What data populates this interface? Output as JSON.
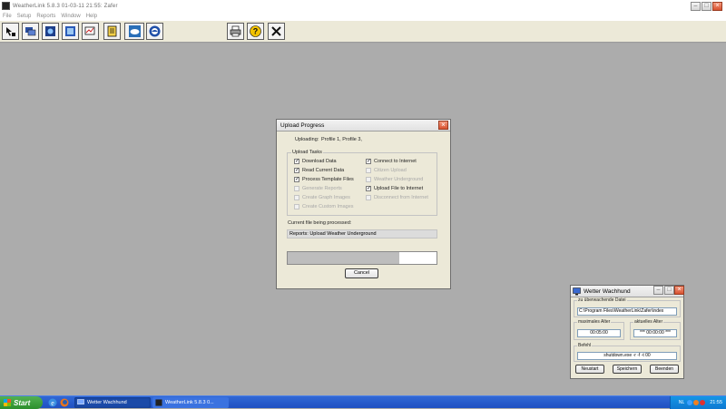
{
  "window": {
    "title": "WeatherLink 5.8.3  01-03-11  21:55: Zafer",
    "menus": [
      "File",
      "Setup",
      "Reports",
      "Window",
      "Help"
    ]
  },
  "toolbar": {
    "buttons": [
      "select-station-icon",
      "walkabout-icon",
      "bulletin-icon",
      "summary-icon",
      "strip-charts-icon",
      "noaa-reports-icon",
      "weather-cloud-icon",
      "noaa-logo-icon",
      "print-icon",
      "help-icon",
      "exit-icon"
    ]
  },
  "upload_dialog": {
    "title": "Upload Progress",
    "uploading_label": "Uploading:",
    "uploading_value": "Profile 1,  Profile 3,",
    "tasks_label": "Upload Tasks",
    "tasks_left": [
      {
        "label": "Download Data",
        "checked": true,
        "enabled": true
      },
      {
        "label": "Read Current Data",
        "checked": true,
        "enabled": true
      },
      {
        "label": "Process Template Files",
        "checked": true,
        "enabled": true
      },
      {
        "label": "Generate Reports",
        "checked": false,
        "enabled": false
      },
      {
        "label": "Create Graph Images",
        "checked": false,
        "enabled": false
      },
      {
        "label": "Create Custom Images",
        "checked": false,
        "enabled": false
      }
    ],
    "tasks_right": [
      {
        "label": "Connect to Internet",
        "checked": true,
        "enabled": true
      },
      {
        "label": "Citizen Upload",
        "checked": false,
        "enabled": false
      },
      {
        "label": "Weather Underground",
        "checked": false,
        "enabled": false
      },
      {
        "label": "Upload File to Internet",
        "checked": true,
        "enabled": true
      },
      {
        "label": "Disconnect from Internet",
        "checked": false,
        "enabled": false
      }
    ],
    "current_file_label": "Current file being processed:",
    "current_file_value": "Reports: Upload Weather Underground",
    "progress": 0.75,
    "cancel_label": "Cancel"
  },
  "watchdog": {
    "title": "Wetter Wachhund",
    "file_label": "zu überwachende Datei",
    "file_value": "C:\\Program Files\\WeatherLink\\Zafer\\index",
    "max_age_label": "maximales Alter",
    "max_age_value": "00:05:00",
    "current_age_label": "aktuelles Alter",
    "current_age_value": "*** 00:00:00 ***",
    "command_label": "Befehl",
    "command_value": "shutdown.exe -r -f -t 00",
    "buttons": [
      "Neustart",
      "Speichern",
      "Beenden"
    ]
  },
  "taskbar": {
    "start_label": "Start",
    "tasks": [
      "Wetter Wachhund",
      "WeatherLink 5.8.3  0..."
    ],
    "lang": "NL",
    "clock": "21:55"
  },
  "colors": {
    "taskbar_blue": "#2458c8",
    "start_green": "#3d9e3d",
    "close_red": "#d8512f",
    "desktop_gray": "#acacac"
  }
}
